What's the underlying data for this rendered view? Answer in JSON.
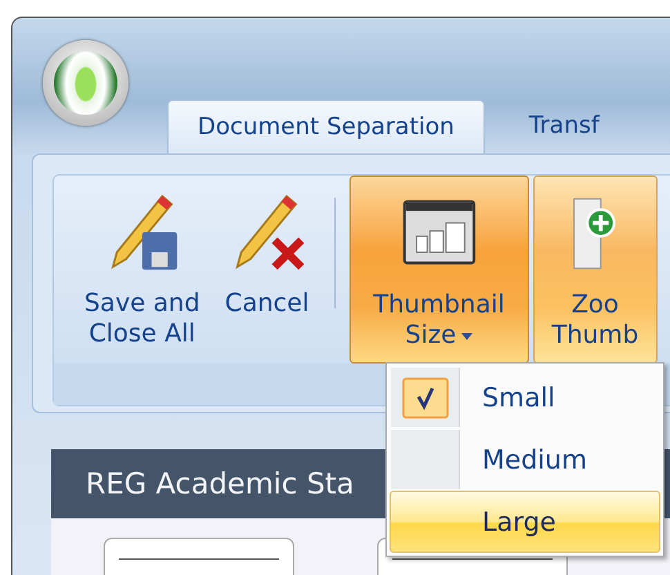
{
  "tabs": [
    {
      "label": "Document Separation",
      "selected": true
    },
    {
      "label": "Transf",
      "selected": false
    }
  ],
  "ribbon_buttons": [
    {
      "kind": "save",
      "lines": [
        "Save and",
        "Close All"
      ],
      "pressed": false,
      "hovered": false,
      "dropdown": false
    },
    {
      "kind": "cancel",
      "lines": [
        "Cancel"
      ],
      "pressed": false,
      "hovered": false,
      "dropdown": false
    },
    {
      "kind": "thumbnail",
      "lines": [
        "Thumbnail",
        "Size"
      ],
      "pressed": true,
      "hovered": false,
      "dropdown": true
    },
    {
      "kind": "zoom",
      "lines": [
        "Zoo",
        "Thumb"
      ],
      "pressed": false,
      "hovered": true,
      "dropdown": false
    }
  ],
  "menu": [
    {
      "label": "Small",
      "checked": true,
      "highlighted": false
    },
    {
      "label": "Medium",
      "checked": false,
      "highlighted": false
    },
    {
      "label": "Large",
      "checked": false,
      "highlighted": true
    }
  ],
  "panel": {
    "title": "REG Academic Sta"
  }
}
